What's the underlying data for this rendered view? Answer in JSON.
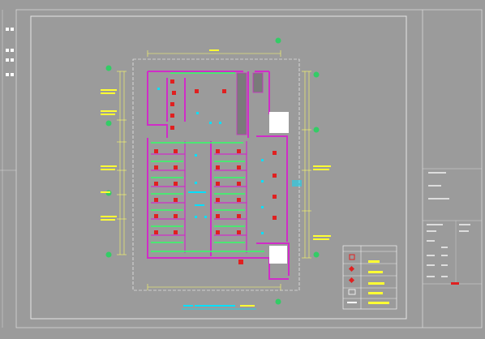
{
  "drawing": {
    "colors": {
      "background": "#9b9b9b",
      "frame": "#d8d8d8",
      "wall": "#d02cc8",
      "dimension": "#ffff66",
      "fixture": "#e02020",
      "pipe": "#33ff66",
      "grid_bubble": "#33cc66",
      "label": "#00e0ff",
      "legend_text": "#ffff33"
    },
    "plan_title": "",
    "legend": {
      "items": [
        {
          "symbol": "square-fixture-icon",
          "text": ""
        },
        {
          "symbol": "diamond-fixture-icon",
          "text": ""
        },
        {
          "symbol": "diamond-fixture-icon",
          "text": ""
        },
        {
          "symbol": "rect-fixture-icon",
          "text": ""
        },
        {
          "symbol": "bar-icon",
          "text": ""
        }
      ]
    },
    "title_block": {
      "rows": 11
    }
  }
}
